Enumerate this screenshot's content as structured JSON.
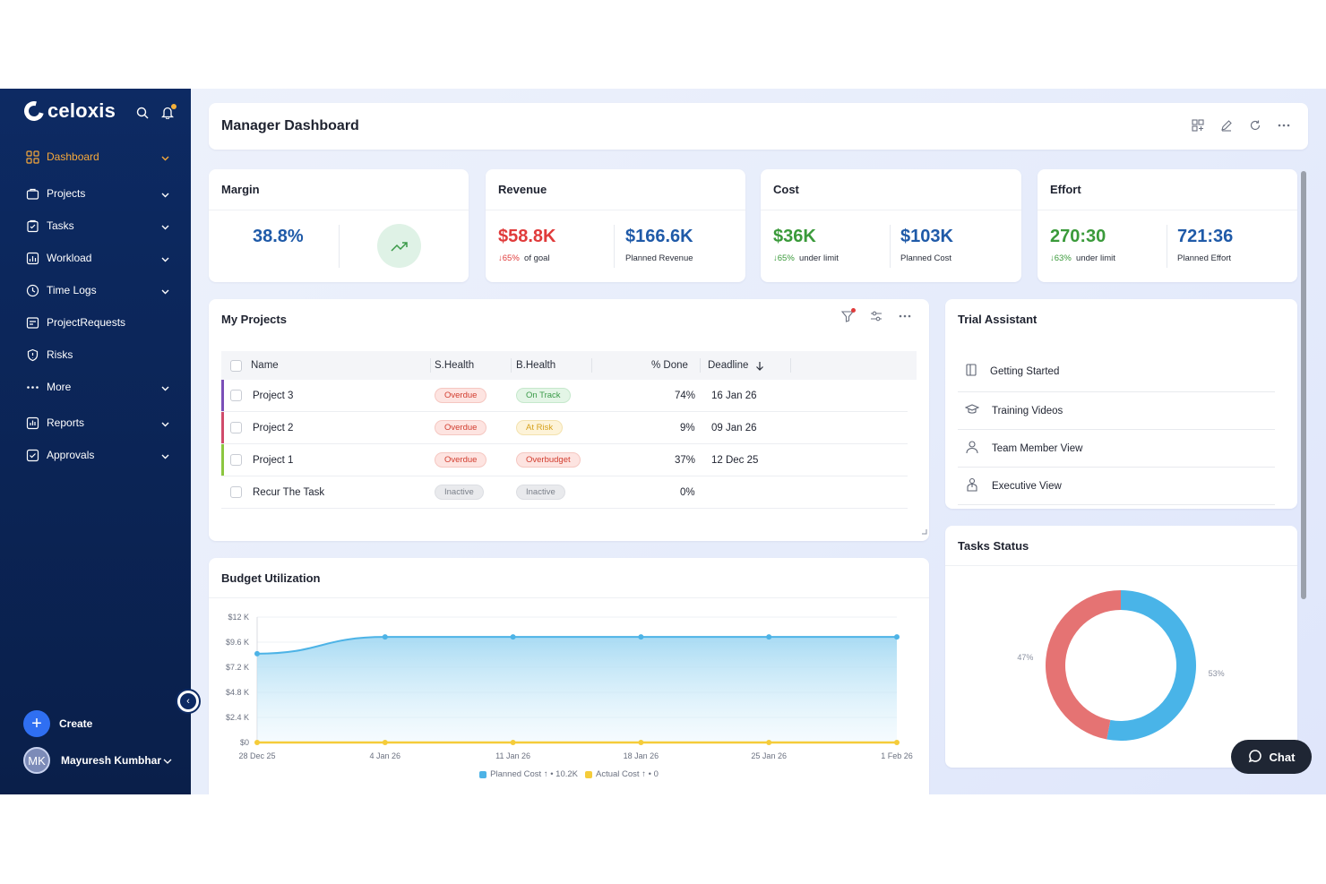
{
  "app": {
    "name": "celoxis"
  },
  "sidebar": {
    "items": [
      {
        "label": "Dashboard",
        "icon": "grid-icon",
        "active": true,
        "chevron": true
      },
      {
        "label": "Projects",
        "icon": "briefcase-icon",
        "chevron": true
      },
      {
        "label": "Tasks",
        "icon": "clipboard-icon",
        "chevron": true
      },
      {
        "label": "Workload",
        "icon": "workload-icon",
        "chevron": true
      },
      {
        "label": "Time Logs",
        "icon": "clock-icon",
        "chevron": true
      },
      {
        "label": "ProjectRequests",
        "icon": "request-icon",
        "chevron": false
      },
      {
        "label": "Risks",
        "icon": "shield-icon",
        "chevron": false
      },
      {
        "label": "More",
        "icon": "more-dots-icon",
        "chevron": true
      },
      {
        "label": "Reports",
        "icon": "report-icon",
        "chevron": true
      },
      {
        "label": "Approvals",
        "icon": "approval-icon",
        "chevron": true
      }
    ],
    "create_label": "Create",
    "user": {
      "initials": "MK",
      "name": "Mayuresh Kumbhar"
    }
  },
  "header": {
    "title": "Manager Dashboard"
  },
  "kpis": {
    "margin": {
      "title": "Margin",
      "value": "38.8%"
    },
    "revenue": {
      "title": "Revenue",
      "actual": "$58.8K",
      "delta": "↓65%",
      "delta_note": "of goal",
      "planned": "$166.6K",
      "planned_label": "Planned Revenue"
    },
    "cost": {
      "title": "Cost",
      "actual": "$36K",
      "delta": "↓65%",
      "delta_note": "under limit",
      "planned": "$103K",
      "planned_label": "Planned Cost"
    },
    "effort": {
      "title": "Effort",
      "actual": "270:30",
      "delta": "↓63%",
      "delta_note": "under limit",
      "planned": "721:36",
      "planned_label": "Planned Effort"
    }
  },
  "projects": {
    "title": "My Projects",
    "columns": {
      "name": "Name",
      "shealth": "S.Health",
      "bhealth": "B.Health",
      "done": "% Done",
      "deadline": "Deadline"
    },
    "rows": [
      {
        "name": "Project 3",
        "shealth": "Overdue",
        "bhealth": "On Track",
        "done": "74%",
        "deadline": "16 Jan 26",
        "bar_color": "#7b4fb8"
      },
      {
        "name": "Project 2",
        "shealth": "Overdue",
        "bhealth": "At Risk",
        "done": "9%",
        "deadline": "09 Jan 26",
        "bar_color": "#d04b6b"
      },
      {
        "name": "Project 1",
        "shealth": "Overdue",
        "bhealth": "Overbudget",
        "done": "37%",
        "deadline": "12 Dec 25",
        "bar_color": "#8cc63f"
      },
      {
        "name": "Recur The Task",
        "shealth": "Inactive",
        "bhealth": "Inactive",
        "done": "0%",
        "deadline": ""
      }
    ]
  },
  "trial": {
    "title": "Trial Assistant",
    "items": [
      {
        "label": "Getting Started",
        "icon": "book-icon"
      },
      {
        "label": "Training Videos",
        "icon": "graduation-cap-icon"
      },
      {
        "label": "Team Member View",
        "icon": "person-icon"
      },
      {
        "label": "Executive View",
        "icon": "executive-icon"
      }
    ]
  },
  "budget": {
    "title": "Budget Utilization",
    "legend": {
      "planned": "Planned Cost ↑ • 10.2K",
      "actual": "Actual Cost ↑ • 0"
    },
    "colors": {
      "planned": "#4db3e6",
      "actual": "#f5cc3a"
    }
  },
  "tasks_status": {
    "title": "Tasks Status",
    "labels": [
      "47%",
      "53%"
    ],
    "colors": [
      "#e57373",
      "#49b4e8"
    ]
  },
  "chat": {
    "label": "Chat"
  },
  "chart_data": [
    {
      "type": "area",
      "title": "Budget Utilization",
      "x": [
        "28 Dec 25",
        "4 Jan 26",
        "11 Jan 26",
        "18 Jan 26",
        "25 Jan 26",
        "1 Feb 26"
      ],
      "yticks": [
        "$0",
        "$2.4 K",
        "$4.8 K",
        "$7.2 K",
        "$9.6 K",
        "$12 K"
      ],
      "ylim": [
        0,
        12000
      ],
      "series": [
        {
          "name": "Planned Cost",
          "values": [
            8500,
            10100,
            10100,
            10100,
            10100,
            10100
          ]
        },
        {
          "name": "Actual Cost",
          "values": [
            0,
            0,
            0,
            0,
            0,
            0
          ]
        }
      ]
    },
    {
      "type": "pie",
      "title": "Tasks Status",
      "values": [
        47,
        53
      ],
      "labels": [
        "47%",
        "53%"
      ]
    }
  ]
}
